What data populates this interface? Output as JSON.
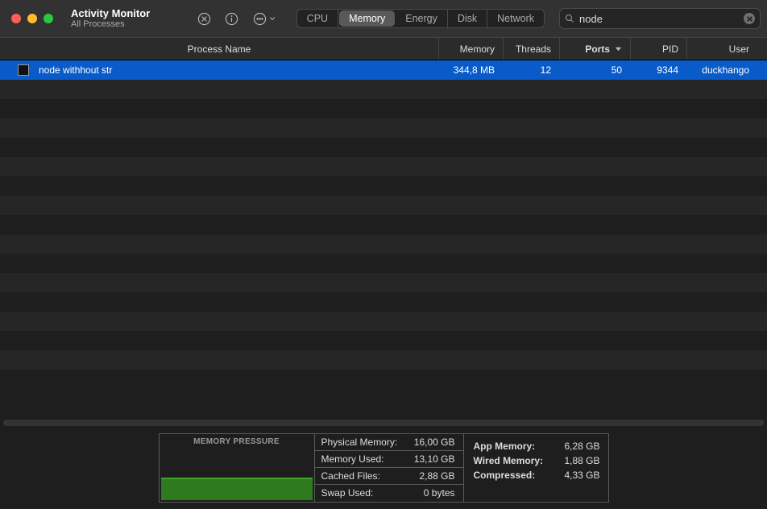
{
  "window": {
    "title": "Activity Monitor",
    "subtitle": "All Processes"
  },
  "tabs": {
    "items": [
      "CPU",
      "Memory",
      "Energy",
      "Disk",
      "Network"
    ],
    "active": "Memory"
  },
  "search": {
    "placeholder": "Search",
    "value": "node"
  },
  "columns": {
    "name": "Process Name",
    "memory": "Memory",
    "threads": "Threads",
    "ports": "Ports",
    "pid": "PID",
    "user": "User",
    "sort_column": "Ports",
    "sort_dir": "desc"
  },
  "rows": [
    {
      "name": "node withhout str",
      "memory": "344,8 MB",
      "threads": "12",
      "ports": "50",
      "pid": "9344",
      "user": "duckhango",
      "selected": true
    }
  ],
  "memory_pressure_label": "MEMORY PRESSURE",
  "stats1": {
    "physical_memory_k": "Physical Memory:",
    "physical_memory_v": "16,00 GB",
    "memory_used_k": "Memory Used:",
    "memory_used_v": "13,10 GB",
    "cached_files_k": "Cached Files:",
    "cached_files_v": "2,88 GB",
    "swap_used_k": "Swap Used:",
    "swap_used_v": "0 bytes"
  },
  "stats2": {
    "app_memory_k": "App Memory:",
    "app_memory_v": "6,28 GB",
    "wired_memory_k": "Wired Memory:",
    "wired_memory_v": "1,88 GB",
    "compressed_k": "Compressed:",
    "compressed_v": "4,33 GB"
  }
}
